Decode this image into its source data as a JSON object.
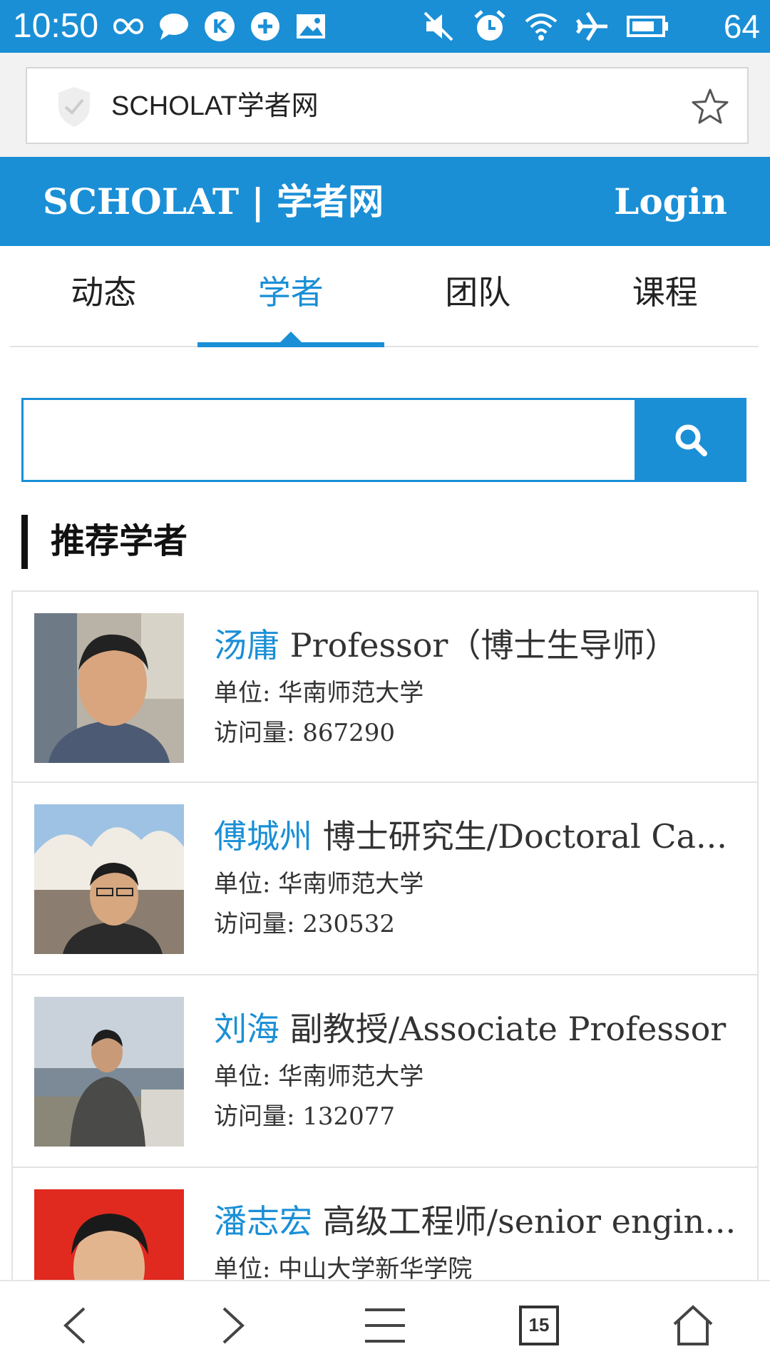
{
  "status_bar": {
    "time": "10:50",
    "battery": "64",
    "left_icons": [
      "infinity-icon",
      "chat-bubble-icon",
      "k-app-icon",
      "sync-icon",
      "image-icon"
    ],
    "right_icons": [
      "mute-icon",
      "alarm-icon",
      "wifi-icon",
      "airplane-icon",
      "battery-icon"
    ]
  },
  "address_bar": {
    "title": "SCHOLAT学者网"
  },
  "header": {
    "logo": "SCHOLAT | 学者网",
    "login": "Login"
  },
  "tabs": [
    {
      "label": "动态",
      "active": false
    },
    {
      "label": "学者",
      "active": true
    },
    {
      "label": "团队",
      "active": false
    },
    {
      "label": "课程",
      "active": false
    }
  ],
  "search": {
    "placeholder": ""
  },
  "section": {
    "title": "推荐学者"
  },
  "scholars": [
    {
      "name": "汤庸",
      "title": "Professor（博士生导师）",
      "unit": "单位: 华南师范大学",
      "visits": "访问量: 867290"
    },
    {
      "name": "傅城州",
      "title": "博士研究生/Doctoral Ca...",
      "unit": "单位: 华南师范大学",
      "visits": "访问量: 230532"
    },
    {
      "name": "刘海",
      "title": "副教授/Associate Professor",
      "unit": "单位: 华南师范大学",
      "visits": "访问量: 132077"
    },
    {
      "name": "潘志宏",
      "title": "高级工程师/senior engin...",
      "unit": "单位: 中山大学新华学院",
      "visits": ""
    }
  ],
  "bottom_nav": {
    "tab_count": "15"
  },
  "colors": {
    "primary": "#1a8fd6",
    "text": "#333333"
  }
}
